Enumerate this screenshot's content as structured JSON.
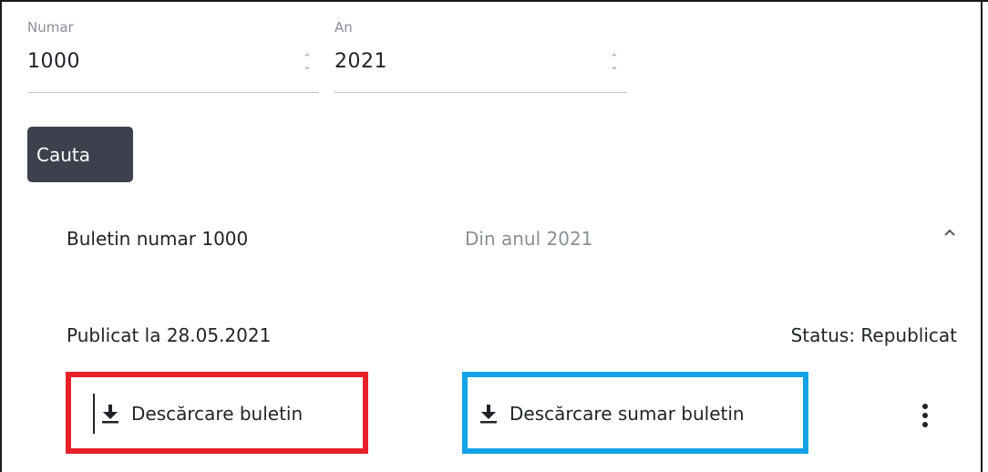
{
  "search_form": {
    "number_field": {
      "label": "Numar",
      "value": "1000"
    },
    "year_field": {
      "label": "An",
      "value": "2021"
    },
    "search_button_label": "Cauta"
  },
  "result": {
    "title": "Buletin numar 1000",
    "year_text": "Din anul 2021",
    "published_text": "Publicat la 28.05.2021",
    "status_text": "Status: Republicat",
    "download_bulletin_label": "Descărcare buletin",
    "download_summary_label": "Descărcare sumar buletin"
  },
  "icons": {
    "stepper": "up-down-stepper-icon",
    "expand": "chevron-up-icon",
    "download": "download-icon",
    "more": "vertical-ellipsis-icon"
  },
  "colors": {
    "button_bg": "#3d414d",
    "highlight_red": "#e8202a",
    "highlight_blue": "#12a3e6",
    "muted_text": "#8a8f96"
  }
}
